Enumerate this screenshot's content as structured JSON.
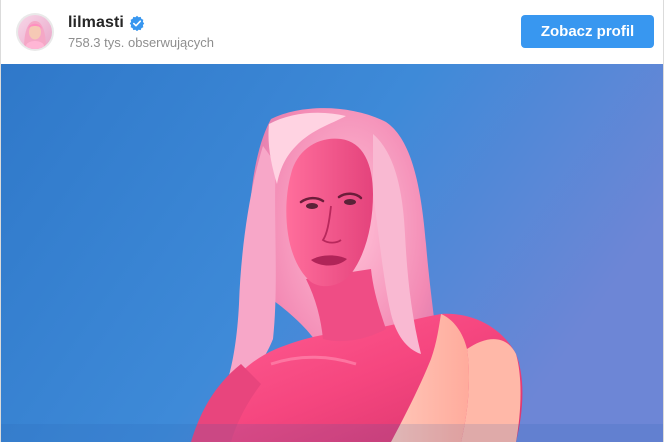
{
  "account": {
    "username": "lilmasti",
    "followers": "758.3 tys. obserwujących"
  },
  "actions": {
    "view_profile_label": "Zobacz profil"
  },
  "icons": {
    "verified": "verified-badge-icon",
    "avatar": "avatar"
  },
  "colors": {
    "accent": "#3897f0",
    "verified": "#3897f0",
    "photo_background": "#3a7fd0",
    "highlight_pink": "#ff6fa8"
  }
}
